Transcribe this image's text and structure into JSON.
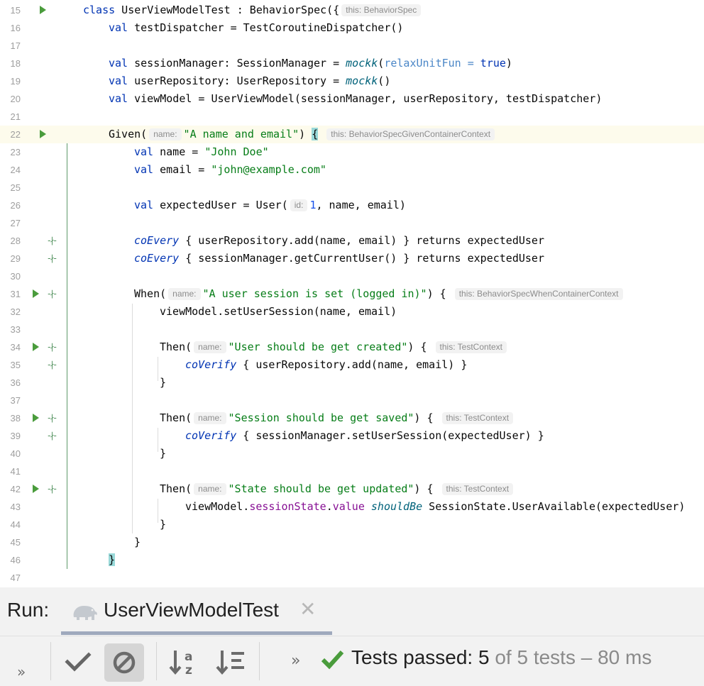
{
  "editor": {
    "lines": [
      {
        "n": "15"
      },
      {
        "n": "16"
      },
      {
        "n": "17"
      },
      {
        "n": "18"
      },
      {
        "n": "19"
      },
      {
        "n": "20"
      },
      {
        "n": "21"
      },
      {
        "n": "22"
      },
      {
        "n": "23"
      },
      {
        "n": "24"
      },
      {
        "n": "25"
      },
      {
        "n": "26"
      },
      {
        "n": "27"
      },
      {
        "n": "28"
      },
      {
        "n": "29"
      },
      {
        "n": "30"
      },
      {
        "n": "31"
      },
      {
        "n": "32"
      },
      {
        "n": "33"
      },
      {
        "n": "34"
      },
      {
        "n": "35"
      },
      {
        "n": "36"
      },
      {
        "n": "37"
      },
      {
        "n": "38"
      },
      {
        "n": "39"
      },
      {
        "n": "40"
      },
      {
        "n": "41"
      },
      {
        "n": "42"
      },
      {
        "n": "43"
      },
      {
        "n": "44"
      },
      {
        "n": "45"
      },
      {
        "n": "46"
      },
      {
        "n": "47"
      }
    ],
    "code": {
      "l15": {
        "kw": "class",
        "name": " UserViewModelTest : BehaviorSpec({",
        "hint": "this: BehaviorSpec"
      },
      "l16": {
        "kw": "val",
        "rest": " testDispatcher = TestCoroutineDispatcher()"
      },
      "l18": {
        "kw": "val",
        "mid": " sessionManager: SessionManager = ",
        "fn": "mockk",
        "open": "(",
        "param": "relaxUnitFun = ",
        "val": "true",
        "close": ")"
      },
      "l19": {
        "kw": "val",
        "mid": " userRepository: UserRepository = ",
        "fn": "mockk",
        "close": "()"
      },
      "l20": {
        "kw": "val",
        "rest": " viewModel = UserViewModel(sessionManager, userRepository, testDispatcher)"
      },
      "l22": {
        "fn": "Given(",
        "hintname": "name:",
        "str": "\"A name and email\"",
        "close": ") ",
        "brace": "{",
        "hint": "this: BehaviorSpecGivenContainerContext"
      },
      "l23": {
        "kw": "val",
        "mid": " name = ",
        "str": "\"John Doe\""
      },
      "l24": {
        "kw": "val",
        "mid": " email = ",
        "str": "\"john@example.com\""
      },
      "l26": {
        "kw": "val",
        "mid": " expectedUser = User(",
        "hintname": "id:",
        "num": "1",
        "close": ", name, email)"
      },
      "l28": {
        "fn": "coEvery",
        "rest": " { userRepository.add(name, email) } returns expectedUser"
      },
      "l29": {
        "fn": "coEvery",
        "rest": " { sessionManager.getCurrentUser() } returns expectedUser"
      },
      "l31": {
        "fn": "When(",
        "hintname": "name:",
        "str": "\"A user session is set (logged in)\"",
        "close": ") {",
        "hint": "this: BehaviorSpecWhenContainerContext"
      },
      "l32": {
        "rest": "viewModel.setUserSession(name, email)"
      },
      "l34": {
        "fn": "Then(",
        "hintname": "name:",
        "str": "\"User should be get created\"",
        "close": ") {",
        "hint": "this: TestContext"
      },
      "l35": {
        "fn": "coVerify",
        "rest": " { userRepository.add(name, email) }"
      },
      "l36": {
        "rest": "}"
      },
      "l38": {
        "fn": "Then(",
        "hintname": "name:",
        "str": "\"Session should be get saved\"",
        "close": ") {",
        "hint": "this: TestContext"
      },
      "l39": {
        "fn": "coVerify",
        "rest": " { sessionManager.setUserSession(expectedUser) }"
      },
      "l40": {
        "rest": "}"
      },
      "l42": {
        "fn": "Then(",
        "hintname": "name:",
        "str": "\"State should be get updated\"",
        "close": ") {",
        "hint": "this: TestContext"
      },
      "l43": {
        "a": "viewModel.",
        "prop": "sessionState",
        "b": ".",
        "prop2": "value",
        "sp": " ",
        "infix": "shouldBe",
        "c": " SessionState.UserAvailable(expectedUser)"
      },
      "l44": {
        "rest": "}"
      },
      "l45": {
        "rest": "}"
      },
      "l46": {
        "brace": "}"
      }
    }
  },
  "run_panel": {
    "label": "Run:",
    "tab_title": "UserViewModelTest",
    "tab_close": "✕",
    "expand_left": "»",
    "expand_right": "»",
    "status_label": "Tests passed:",
    "passed_count": "5",
    "rest": "of 5 tests – 80 ms",
    "icons": {
      "tab": "gradle-elephant-icon",
      "show_passed": "check-icon",
      "show_ignored": "ignored-icon",
      "sort_alpha": "sort-alphabetically-icon",
      "sort_duration": "sort-by-duration-icon",
      "status": "passed-check-icon"
    },
    "colors": {
      "pass": "#4a9c3c",
      "toggle_active": "#d5d5d5"
    }
  }
}
